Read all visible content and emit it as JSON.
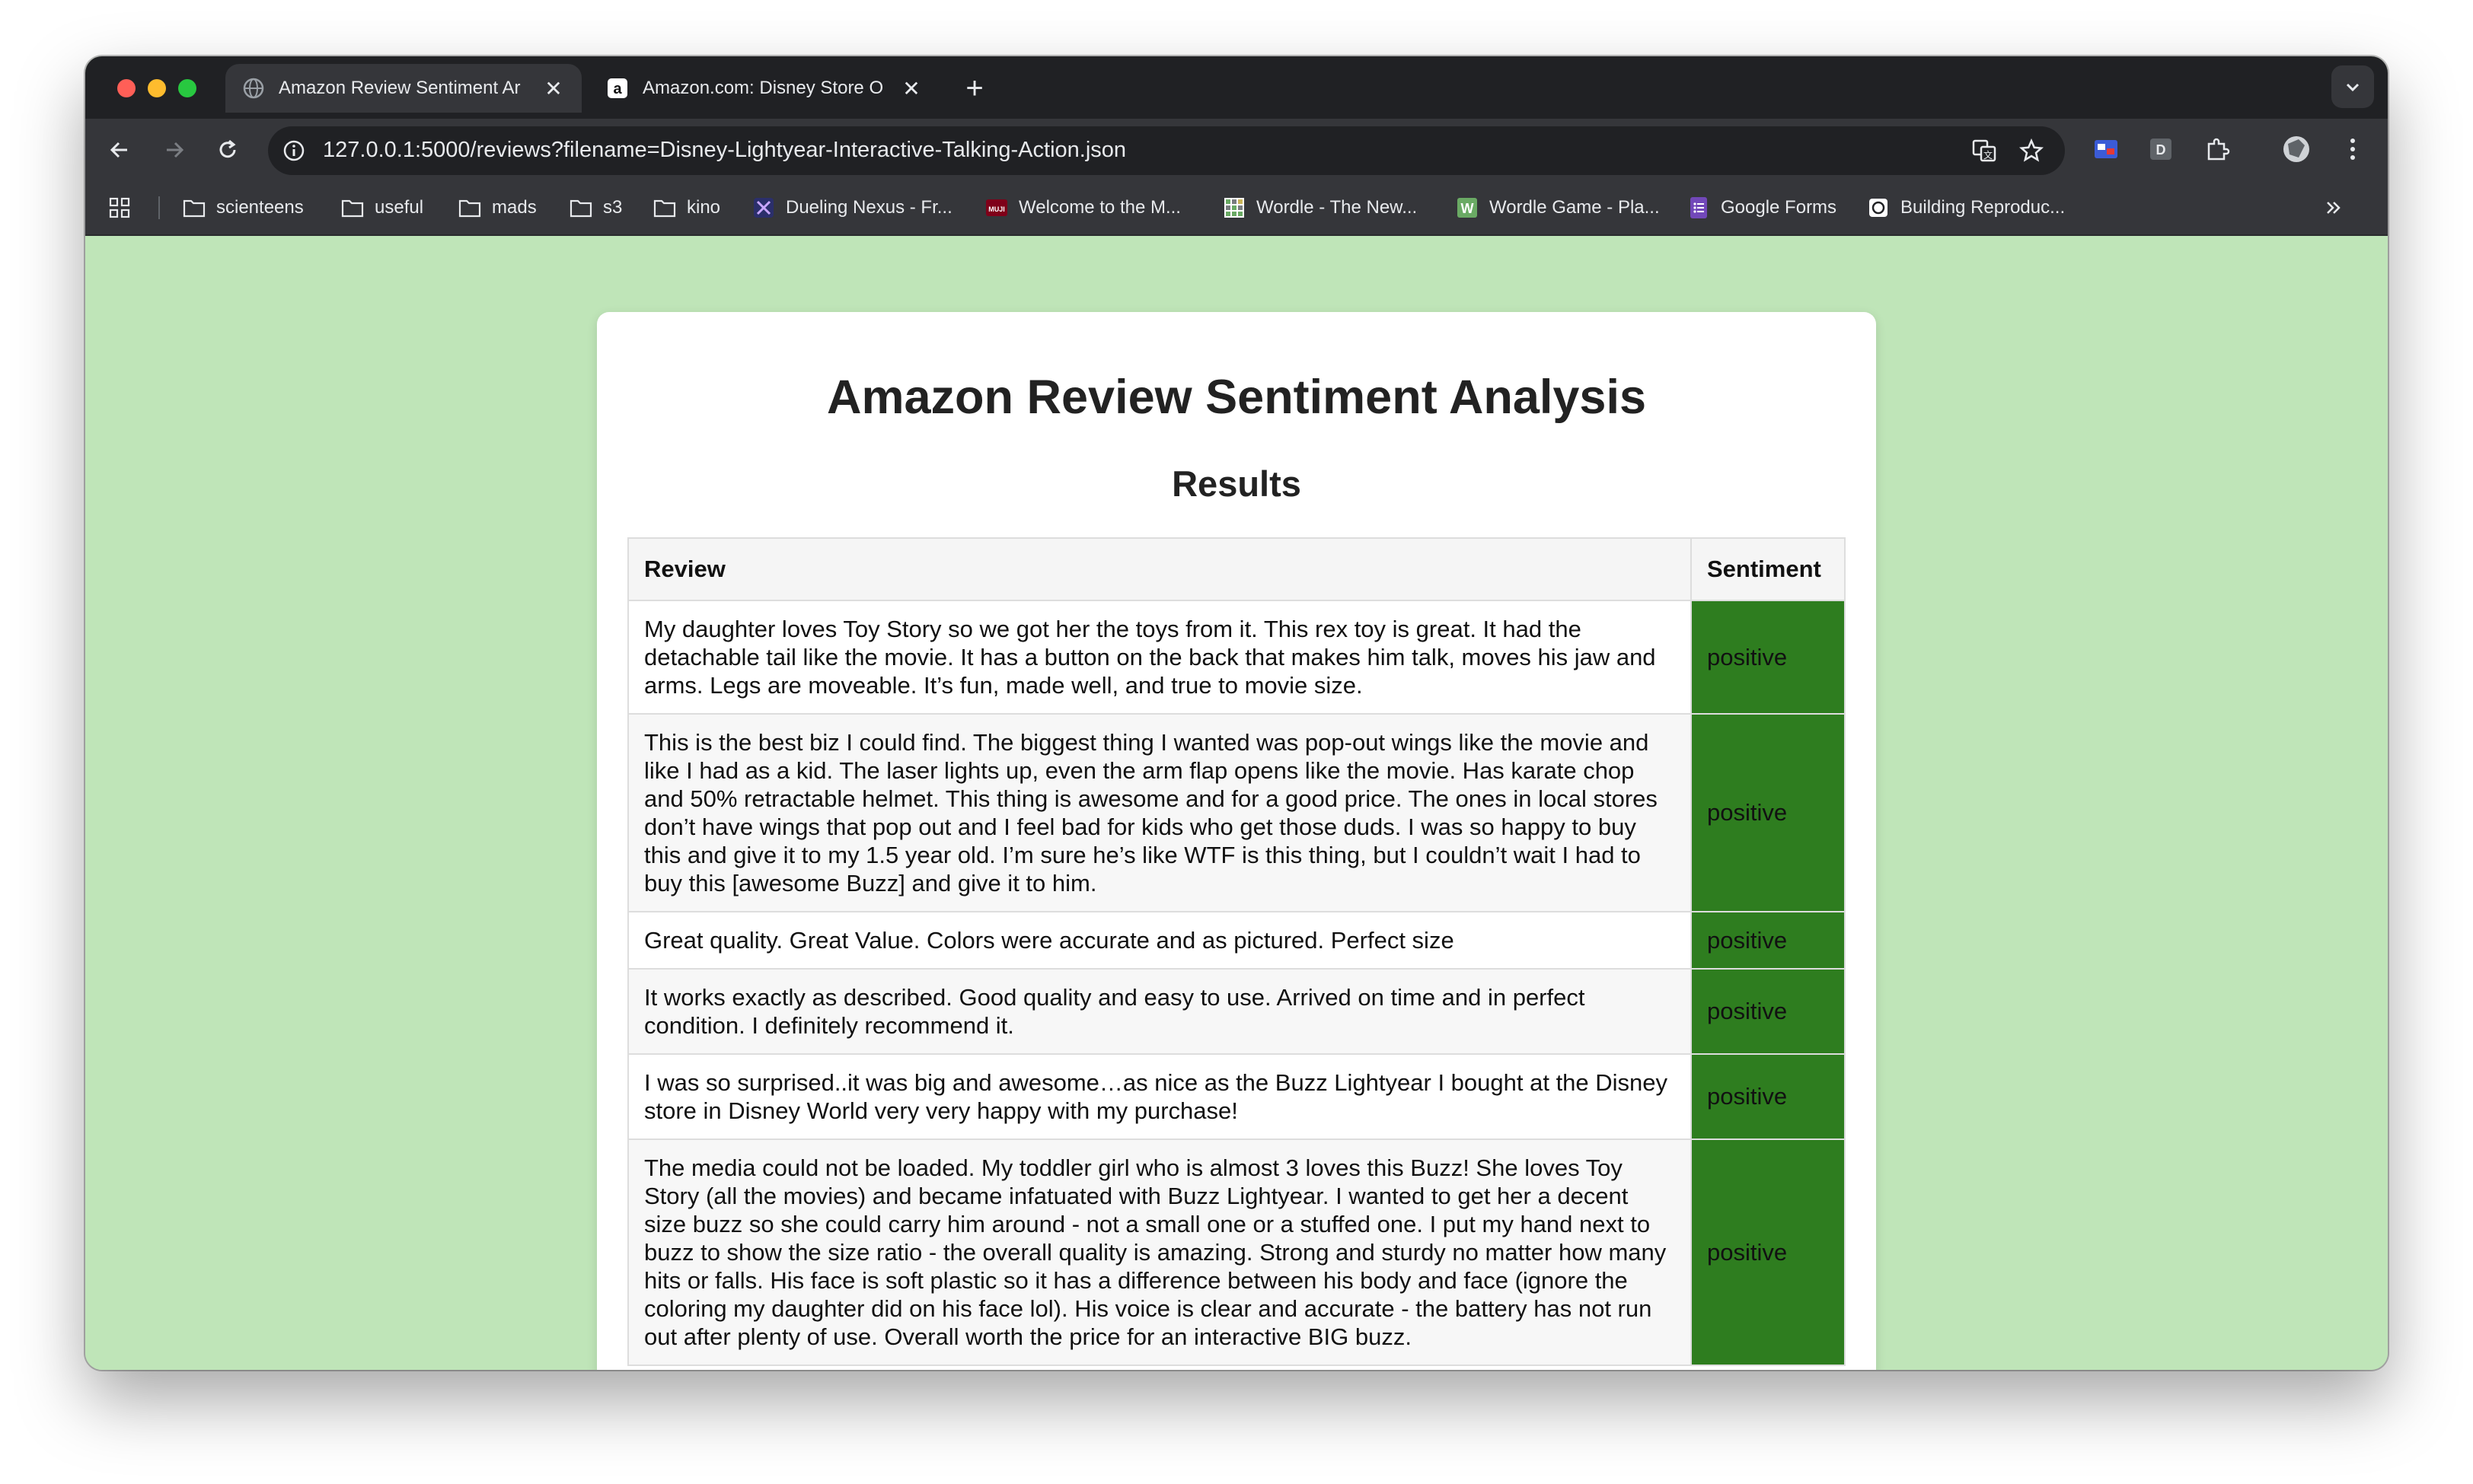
{
  "tabs": [
    {
      "title": "Amazon Review Sentiment Ar",
      "icon": "globe-icon",
      "active": true
    },
    {
      "title": "Amazon.com: Disney Store O",
      "icon": "amazon-icon",
      "active": false
    }
  ],
  "address_bar": {
    "url": "127.0.0.1:5000/reviews?filename=Disney-Lightyear-Interactive-Talking-Action.json"
  },
  "bookmarks": [
    {
      "label": "scienteens",
      "icon": "folder-icon"
    },
    {
      "label": "useful",
      "icon": "folder-icon"
    },
    {
      "label": "mads",
      "icon": "folder-icon"
    },
    {
      "label": "s3",
      "icon": "folder-icon"
    },
    {
      "label": "kino",
      "icon": "folder-icon"
    },
    {
      "label": "Dueling Nexus - Fr...",
      "icon": "dueling-nexus-icon"
    },
    {
      "label": "Welcome to the M...",
      "icon": "muji-icon"
    },
    {
      "label": "Wordle - The New...",
      "icon": "wordle-grid-icon"
    },
    {
      "label": "Wordle Game - Pla...",
      "icon": "wordle-w-icon"
    },
    {
      "label": "Google Forms",
      "icon": "google-forms-icon"
    },
    {
      "label": "Building Reproduc...",
      "icon": "page-icon"
    }
  ],
  "page": {
    "title": "Amazon Review Sentiment Analysis",
    "subtitle": "Results",
    "columns": [
      "Review",
      "Sentiment"
    ],
    "rows": [
      {
        "review": "My daughter loves Toy Story so we got her the toys from it. This rex toy is great. It had the detachable tail like the movie. It has a button on the back that makes him talk, moves his jaw and arms. Legs are moveable. It’s fun, made well, and true to movie size.",
        "sentiment": "positive"
      },
      {
        "review": "This is the best biz I could find. The biggest thing I wanted was pop-out wings like the movie and like I had as a kid. The laser lights up, even the arm flap opens like the movie. Has karate chop and 50% retractable helmet. This thing is awesome and for a good price. The ones in local stores don’t have wings that pop out and I feel bad for kids who get those duds. I was so happy to buy this and give it to my 1.5 year old. I’m sure he’s like WTF is this thing, but I couldn’t wait I had to buy this [awesome Buzz] and give it to him.",
        "sentiment": "positive"
      },
      {
        "review": "Great quality. Great Value. Colors were accurate and as pictured. Perfect size",
        "sentiment": "positive"
      },
      {
        "review": "It works exactly as described. Good quality and easy to use. Arrived on time and in perfect condition. I definitely recommend it.",
        "sentiment": "positive"
      },
      {
        "review": "I was so surprised..it was big and awesome…as nice as the Buzz Lightyear I bought at the Disney store in Disney World very very happy with my purchase!",
        "sentiment": "positive"
      },
      {
        "review": "The media could not be loaded. My toddler girl who is almost 3 loves this Buzz! She loves Toy Story (all the movies) and became infatuated with Buzz Lightyear. I wanted to get her a decent size buzz so she could carry him around - not a small one or a stuffed one. I put my hand next to buzz to show the size ratio - the overall quality is amazing. Strong and sturdy no matter how many hits or falls. His face is soft plastic so it has a difference between his body and face (ignore the coloring my daughter did on his face lol). His voice is clear and accurate - the battery has not run out after plenty of use. Overall worth the price for an interactive BIG buzz.",
        "sentiment": "positive"
      }
    ]
  },
  "colors": {
    "page_background": "#bfe5b8",
    "positive_cell": "#2e7d1f",
    "browser_frame": "#202124",
    "toolbar": "#35363a"
  }
}
